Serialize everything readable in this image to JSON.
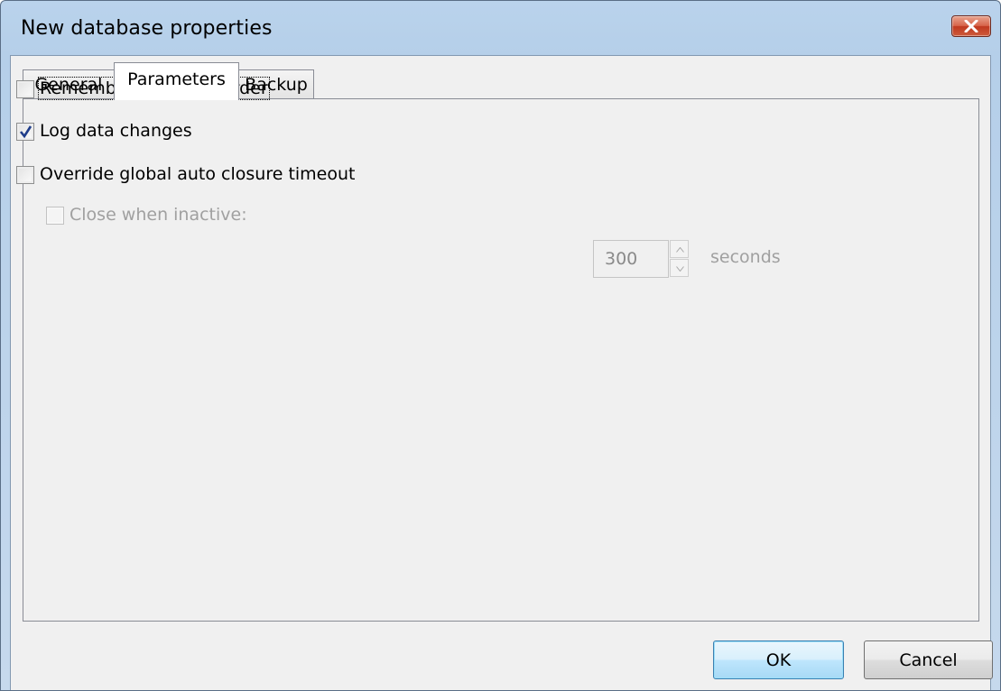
{
  "window": {
    "title": "New database properties",
    "close_icon": "close-x-icon"
  },
  "tabs": [
    {
      "label": "General",
      "active": false
    },
    {
      "label": "Parameters",
      "active": true
    },
    {
      "label": "Backup",
      "active": false
    }
  ],
  "parameters": {
    "remember_sort": {
      "label": "Remember data sort order",
      "checked": false,
      "enabled": true
    },
    "log_changes": {
      "label": "Log data changes",
      "checked": true,
      "enabled": true
    },
    "override_timeout": {
      "label": "Override global auto closure timeout",
      "checked": false,
      "enabled": true
    },
    "close_inactive": {
      "label": "Close when inactive:",
      "checked": false,
      "enabled": false
    },
    "timeout_value": "300",
    "timeout_unit": "seconds"
  },
  "buttons": {
    "ok": "OK",
    "cancel": "Cancel"
  },
  "colors": {
    "title_bar": "#b9d1ea",
    "close_button": "#c7452a",
    "ok_button_border": "#3c7fb1",
    "check_mark": "#1f3d8a"
  }
}
